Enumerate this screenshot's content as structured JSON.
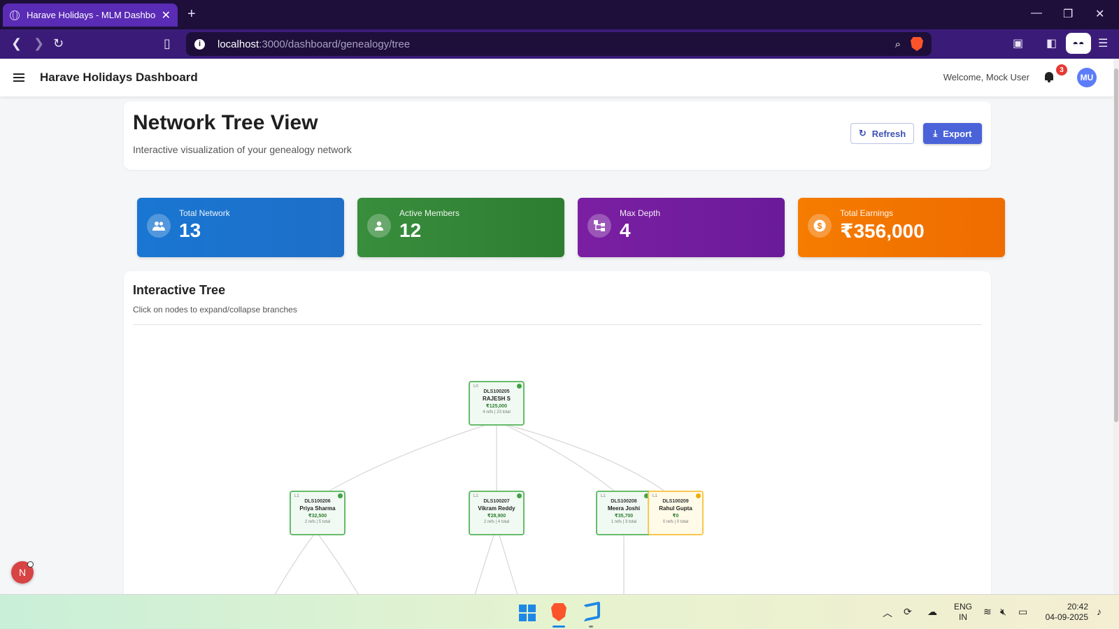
{
  "browser": {
    "tab_title": "Harave Holidays - MLM Dashboard",
    "new_tab": "+",
    "url_host": "localhost",
    "url_path": ":3000/dashboard/genealogy/tree"
  },
  "header": {
    "title": "Harave Holidays Dashboard",
    "welcome": "Welcome, Mock User",
    "notifications": "3",
    "avatar": "MU"
  },
  "page": {
    "title": "Network Tree View",
    "subtitle": "Interactive visualization of your genealogy network",
    "refresh_label": "Refresh",
    "export_label": "Export"
  },
  "stats": [
    {
      "label": "Total Network",
      "value": "13",
      "icon": "people-icon"
    },
    {
      "label": "Active Members",
      "value": "12",
      "icon": "person-icon"
    },
    {
      "label": "Max Depth",
      "value": "4",
      "icon": "hierarchy-icon"
    },
    {
      "label": "Total Earnings",
      "value": "₹356,000",
      "icon": "dollar-icon"
    }
  ],
  "tree": {
    "title": "Interactive Tree",
    "subtitle": "Click on nodes to expand/collapse branches",
    "nodes": [
      {
        "level": "L0",
        "id": "DLS100205",
        "name": "RAJESH S",
        "earnings": "₹125,000",
        "refs": "4 refs | 23 total",
        "status": "active"
      },
      {
        "level": "L1",
        "id": "DLS100206",
        "name": "Priya Sharma",
        "earnings": "₹32,500",
        "refs": "2 refs | 5 total",
        "status": "active"
      },
      {
        "level": "L1",
        "id": "DLS100207",
        "name": "Vikram Reddy",
        "earnings": "₹28,900",
        "refs": "2 refs | 4 total",
        "status": "active"
      },
      {
        "level": "L1",
        "id": "DLS100208",
        "name": "Meera Joshi",
        "earnings": "₹35,700",
        "refs": "1 refs | 3 total",
        "status": "active"
      },
      {
        "level": "L1",
        "id": "DLS100209",
        "name": "Rahul Gupta",
        "earnings": "₹0",
        "refs": "0 refs | 0 total",
        "status": "pending"
      }
    ]
  },
  "fab": {
    "label": "N"
  },
  "taskbar": {
    "lang_top": "ENG",
    "lang_bottom": "IN",
    "time": "20:42",
    "date": "04-09-2025"
  },
  "colors": {
    "stat_blue": "#1976d2",
    "stat_green": "#388e3c",
    "stat_purple": "#7b1fa2",
    "stat_orange": "#f57c00",
    "accent": "#4a63d9"
  }
}
